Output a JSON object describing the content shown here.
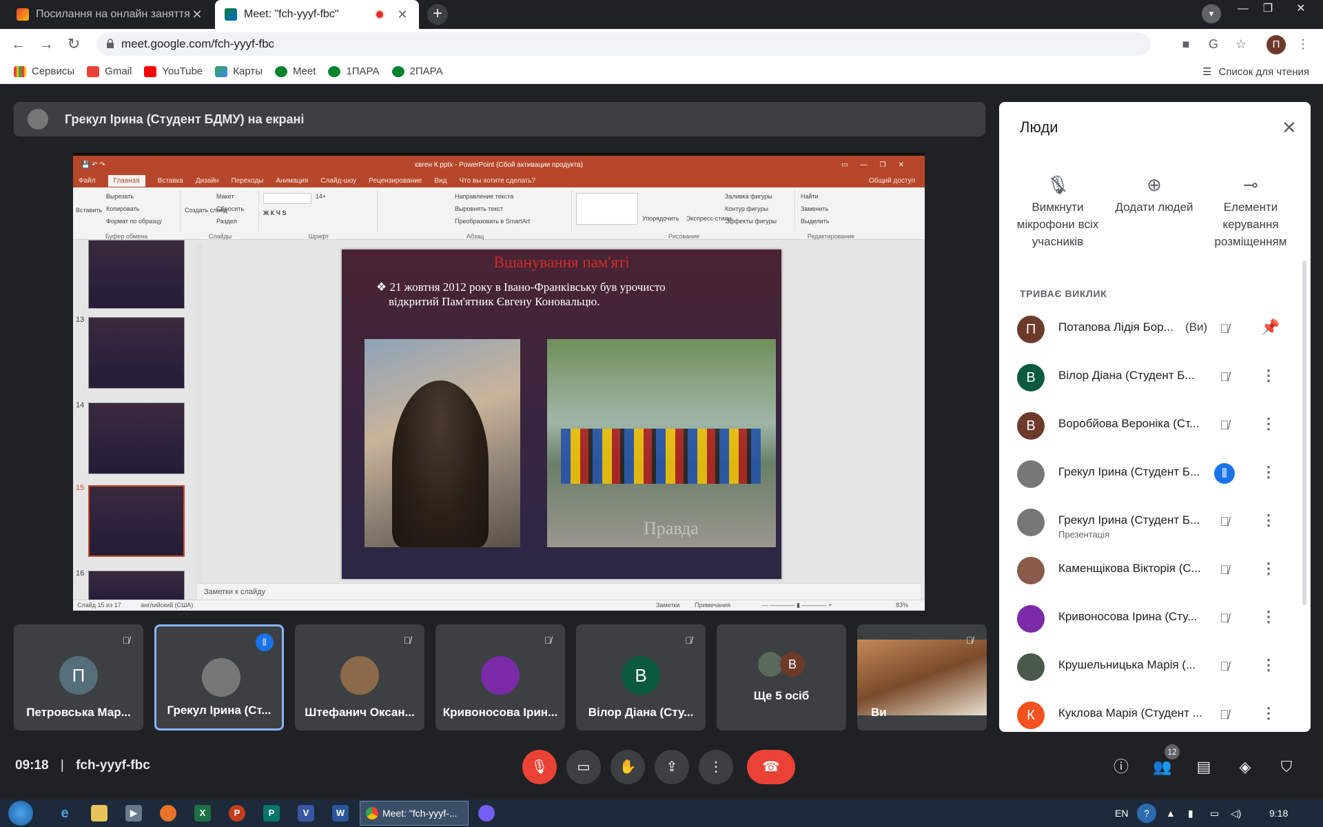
{
  "browser": {
    "tabs": [
      {
        "title": "Посилання на онлайн заняття 0",
        "active": false
      },
      {
        "title": "Meet: \"fch-yyyf-fbc\"",
        "active": true
      }
    ],
    "url": "meet.google.com/fch-yyyf-fbc",
    "profile_initial": "П",
    "bookmarks": [
      "Сервисы",
      "Gmail",
      "YouTube",
      "Карты",
      "Meet",
      "1ПАРА",
      "2ПАРА"
    ],
    "reading_list": "Список для чтения"
  },
  "presenter_bar": {
    "label": "Грекул Ірина (Студент БДМУ) на екрані"
  },
  "ppt": {
    "window_title": "євген К.pptx - PowerPoint (Сбой активации продукта)",
    "tabs": [
      "Файл",
      "Главная",
      "Вставка",
      "Дизайн",
      "Переходы",
      "Анимация",
      "Слайд-шоу",
      "Рецензирование",
      "Вид",
      "Что вы хотите сделать?"
    ],
    "share": "Общий доступ",
    "ribbon": {
      "clipboard": {
        "paste": "Вставить",
        "cut": "Вырезать",
        "copy": "Копировать",
        "format": "Формат по образцу",
        "label": "Буфер обмена"
      },
      "slides": {
        "create": "Создать слайд",
        "layout": "Макет",
        "reset": "Сбросить",
        "section": "Раздел",
        "label": "Слайды"
      },
      "font": {
        "size": "14+",
        "label": "Шрифт"
      },
      "paragraph": {
        "direction": "Направление текста",
        "align": "Выровнять текст",
        "smartart": "Преобразовать в SmartArt",
        "label": "Абзац"
      },
      "drawing": {
        "arrange": "Упорядочить",
        "styles": "Экспресс-стили",
        "fill": "Заливка фигуры",
        "outline": "Контур фигуры",
        "effects": "Эффекты фигуры",
        "label": "Рисование"
      },
      "editing": {
        "find": "Найти",
        "replace": "Заменить",
        "select": "Выделить",
        "label": "Редактирование"
      }
    },
    "thumbs": [
      {
        "num": "",
        "top": 0
      },
      {
        "num": "13"
      },
      {
        "num": "14"
      },
      {
        "num": "15"
      },
      {
        "num": "16"
      }
    ],
    "slide": {
      "heading": "Вшанування пам'яті",
      "bullet": "❖ 21 жовтня 2012 року в Івано-Франківську був урочисто",
      "bullet2": "відкритий Пам'ятник Євгену Коновальцю.",
      "watermark": "Правда"
    },
    "notes": "Заметки к слайду",
    "status": "Слайд 15 из 17",
    "lang": "английский (США)",
    "status_notes": "Заметки",
    "status_comments": "Примечания",
    "zoom": "83%"
  },
  "people": {
    "title": "Люди",
    "actions": [
      {
        "label": "Вимкнути мікрофони всіх учасників",
        "icon": "🎙"
      },
      {
        "label": "Додати людей",
        "icon": "👤+"
      },
      {
        "label": "Елементи керування розміщенням",
        "icon": "⊸"
      }
    ],
    "section": "ТРИВАЄ ВИКЛИК",
    "list": [
      {
        "initial": "П",
        "name": "Потапова Лідія Бор...",
        "you": "(Ви)",
        "color": "#6d3a2a",
        "speaking": false,
        "pin": true
      },
      {
        "initial": "В",
        "name": "Вілор Діана (Студент Б...",
        "color": "#0b5a3e",
        "speaking": false
      },
      {
        "initial": "В",
        "name": "Воробйова Вероніка (Ст...",
        "color": "#6d3a2a",
        "speaking": false
      },
      {
        "initial": "",
        "name": "Грекул Ірина (Студент Б...",
        "color": "#777777",
        "speaking": true
      },
      {
        "initial": "",
        "name": "Грекул Ірина (Студент Б...",
        "sub": "Презентація",
        "color": "#777777",
        "speaking": false
      },
      {
        "initial": "",
        "name": "Каменщікова Вікторія (С...",
        "color": "#8a5a4a",
        "speaking": false
      },
      {
        "initial": "",
        "name": "Кривоносова Ірина (Сту...",
        "color": "#7b2aa8",
        "speaking": false
      },
      {
        "initial": "",
        "name": "Крушельницька Марія (...",
        "color": "#4a5a4a",
        "speaking": false
      },
      {
        "initial": "К",
        "name": "Куклова Марія (Студент ...",
        "color": "#f4511e",
        "speaking": false
      }
    ]
  },
  "tiles": [
    {
      "initial": "П",
      "name": "Петровська Мар...",
      "color": "#546e7a",
      "speaking": false
    },
    {
      "initial": "",
      "name": "Грекул Ірина (Ст...",
      "color": "#777777",
      "speaking": true,
      "active": true
    },
    {
      "initial": "",
      "name": "Штефанич Оксан...",
      "color": "#8a6a4a",
      "speaking": false
    },
    {
      "initial": "",
      "name": "Кривоносова Ірин...",
      "color": "#7b2aa8",
      "speaking": false
    },
    {
      "initial": "В",
      "name": "Вілор Діана (Сту...",
      "color": "#0b5a3e",
      "speaking": false
    },
    {
      "initial": "В",
      "name": "Ще 5 осіб",
      "color": "#6d3a2a",
      "speaking": false
    },
    {
      "initial": "",
      "name": "Ви",
      "color": "#a88a70",
      "speaking": false
    }
  ],
  "meeting": {
    "time": "09:18",
    "code": "fch-yyyf-fbc",
    "participants_count": "12"
  },
  "taskbar": {
    "chrome_label": "Meet: \"fch-yyyf-...",
    "lang": "EN",
    "clock": "9:18"
  }
}
